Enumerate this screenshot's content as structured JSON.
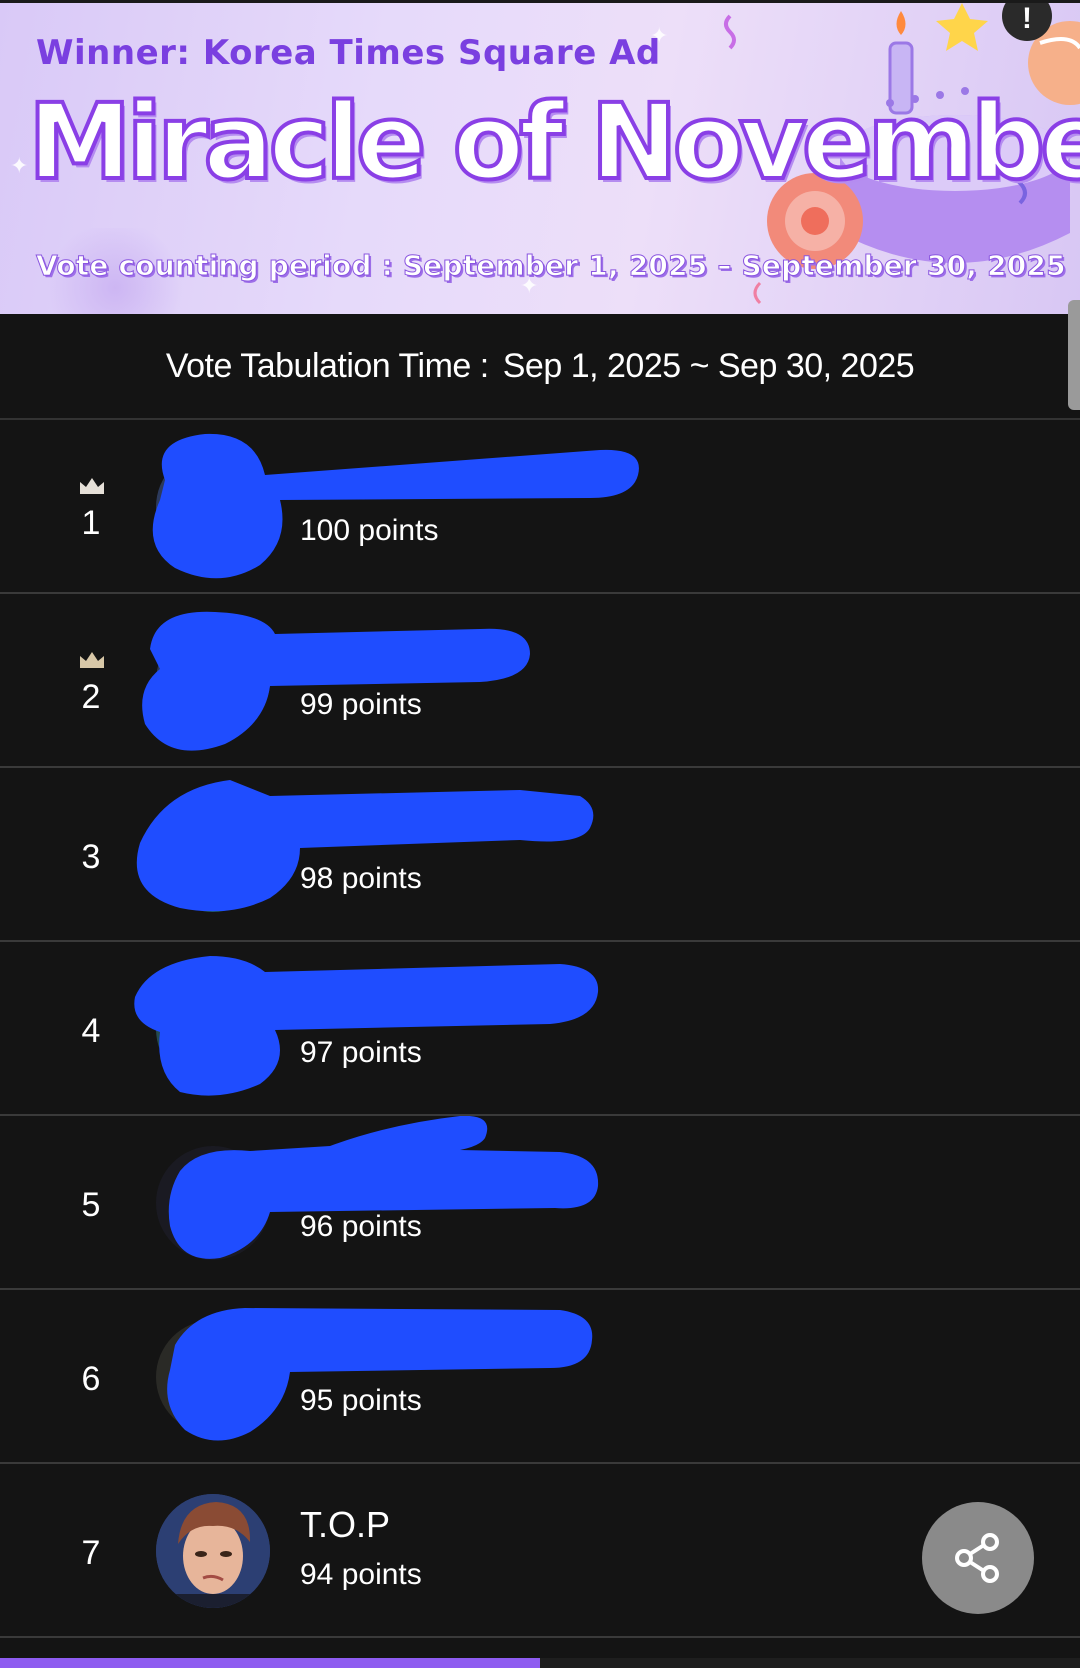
{
  "banner": {
    "winner": "Winner: Korea Times Square Ad",
    "title": "Miracle of November",
    "period": "Vote counting period : September 1, 2025 – September 30, 2025",
    "info_icon": "info-icon"
  },
  "tabulation": {
    "label": "Vote Tabulation Time :",
    "value": "Sep 1, 2025 ~ Sep 30, 2025"
  },
  "ranking": [
    {
      "rank": "1",
      "name": "",
      "points": "100 points",
      "crown": true,
      "redacted": true
    },
    {
      "rank": "2",
      "name": "",
      "points": "99 points",
      "crown": true,
      "redacted": true
    },
    {
      "rank": "3",
      "name": "",
      "points": "98 points",
      "crown": false,
      "redacted": true
    },
    {
      "rank": "4",
      "name": "",
      "points": "97 points",
      "crown": false,
      "redacted": true
    },
    {
      "rank": "5",
      "name": "",
      "points": "96 points",
      "crown": false,
      "redacted": true
    },
    {
      "rank": "6",
      "name": "",
      "points": "95 points",
      "crown": false,
      "redacted": true
    },
    {
      "rank": "7",
      "name": "T.O.P",
      "points": "94 points",
      "crown": false,
      "redacted": false
    }
  ],
  "share": {
    "icon": "share-icon"
  },
  "colors": {
    "background": "#141414",
    "accent": "#8e5cf0",
    "redaction": "#1f4dff",
    "crown": "#d8c8a8"
  },
  "scroll_progress": 0.5
}
